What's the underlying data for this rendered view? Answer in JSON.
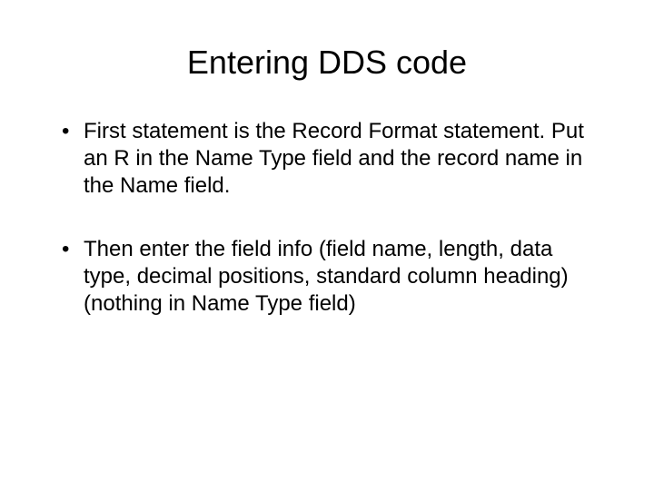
{
  "title": "Entering DDS code",
  "bullets": [
    "First statement is the Record Format statement. Put an R in the Name Type field and the record name in the Name field.",
    "Then enter the field info (field name, length, data type, decimal positions, standard column heading) (nothing in Name Type field)"
  ],
  "bullet_marker": "•"
}
